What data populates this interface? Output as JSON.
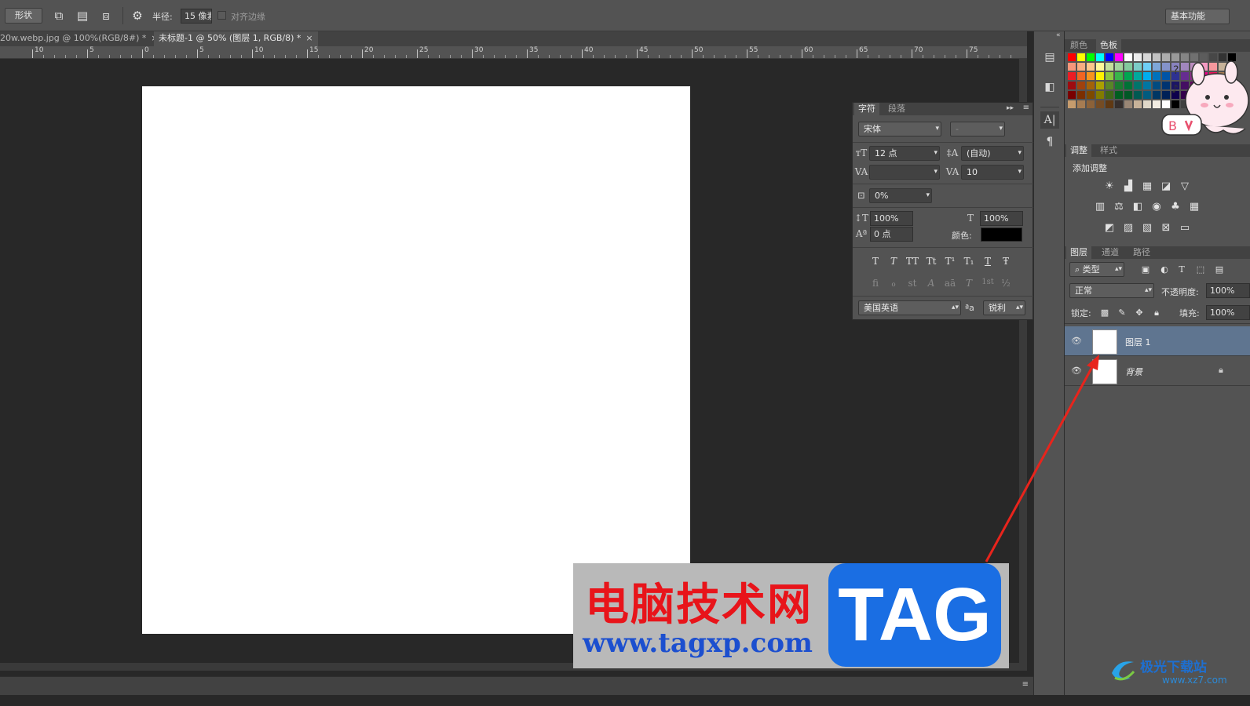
{
  "options_bar": {
    "shape_button": "形状",
    "radius_label": "半径:",
    "radius_value": "15 像素",
    "align_edges_label": "对齐边缘",
    "workspace": "基本功能"
  },
  "doc_tabs": [
    {
      "label": "20w.webp.jpg @ 100%(RGB/8#) *",
      "close": "×"
    },
    {
      "label": "未标题-1 @ 50% (图层 1, RGB/8) *",
      "close": "×"
    }
  ],
  "ruler_labels": [
    "10",
    "5",
    "0",
    "5",
    "10",
    "15",
    "20",
    "25",
    "30",
    "35",
    "40",
    "45",
    "50",
    "55",
    "60",
    "65",
    "70",
    "75"
  ],
  "swatches_panel": {
    "tabs": [
      "颜色",
      "色板"
    ],
    "colors": [
      "#ff0000",
      "#ffff00",
      "#00ff00",
      "#00ffff",
      "#0000ff",
      "#ff00ff",
      "#ffffff",
      "#ebebeb",
      "#d6d6d6",
      "#c2c2c2",
      "#adadad",
      "#999999",
      "#858585",
      "#707070",
      "#5c5c5c",
      "#474747",
      "#333333",
      "#000000"
    ]
  },
  "adjustments_panel": {
    "tabs": [
      "调整",
      "样式"
    ],
    "title": "添加调整"
  },
  "layers_panel": {
    "tabs": [
      "图层",
      "通道",
      "路径"
    ],
    "filter_kind": "类型",
    "blend_mode": "正常",
    "opacity_label": "不透明度:",
    "opacity_value": "100%",
    "lock_label": "锁定:",
    "fill_label": "填充:",
    "fill_value": "100%",
    "layers": [
      {
        "name": "图层 1",
        "selected": true
      },
      {
        "name": "背景",
        "selected": false
      }
    ]
  },
  "character_panel": {
    "tabs": [
      "字符",
      "段落"
    ],
    "font_family": "宋体",
    "font_style": "-",
    "font_size": "12 点",
    "leading": "(自动)",
    "kerning": "",
    "tracking": "10",
    "scale_percent": "0%",
    "vertical_scale": "100%",
    "horizontal_scale": "100%",
    "baseline_shift": "0 点",
    "color_label": "颜色:",
    "type_buttons": [
      "T",
      "T",
      "TT",
      "Tt",
      "T¹",
      "T₁",
      "T",
      "Ŧ"
    ],
    "opentype_buttons": [
      "fi",
      "ℴ",
      "st",
      "A",
      "aā",
      "T",
      "1st",
      "½"
    ],
    "language": "美国英语",
    "aa_label": "ªa",
    "antialias": "锐利"
  },
  "watermark": {
    "cn_text": "电脑技术网",
    "url": "www.tagxp.com",
    "tag": "TAG"
  },
  "corner_watermark": {
    "name": "极光下载站",
    "url": "www.xz7.com"
  },
  "colors": {
    "selected_layer": "#5f7590",
    "arrow": "#e8241c",
    "wm_blue": "#1a6ee3",
    "wm_red": "#e8141a"
  }
}
